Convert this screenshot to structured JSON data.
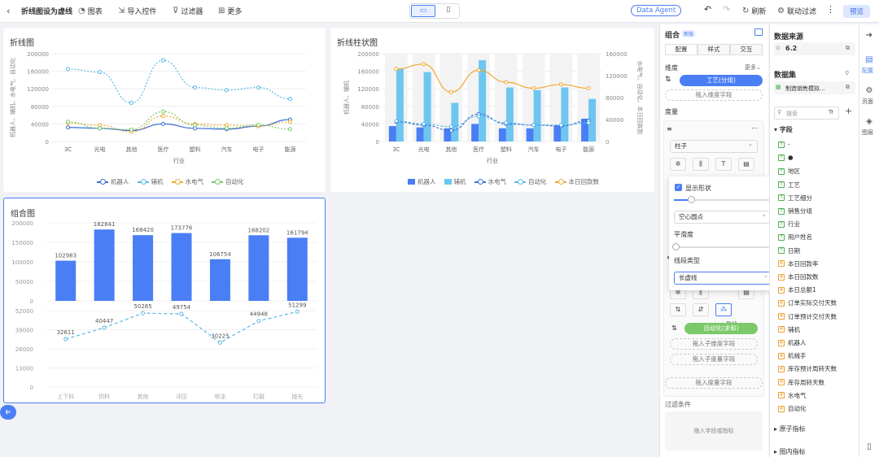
{
  "topbar": {
    "back_icon": "chevron-left-icon",
    "title": "折线图设为虚线",
    "chart_btn": "图表",
    "import_btn": "导入控件",
    "filter_btn": "过滤器",
    "more_btn": "更多",
    "data_agent": "Data Agent",
    "refresh": "刷新",
    "linked_filter": "联动过滤",
    "preview": "预览"
  },
  "cards": {
    "line_title": "折线图",
    "linebar_title": "折线柱状图",
    "combo_title": "组合图"
  },
  "chart_data": [
    {
      "type": "line",
      "title": "折线图",
      "categories": [
        "3C",
        "光电",
        "其他",
        "医疗",
        "塑料",
        "汽车",
        "电子",
        "能源"
      ],
      "xlabel": "行业",
      "ylabel": "机器人、辅机、水电气、自动化",
      "ylim": [
        0,
        200000
      ],
      "yticks": [
        "0",
        "40000",
        "80000",
        "120000",
        "160000",
        "200000"
      ],
      "series": [
        {
          "name": "机器人",
          "color": "#3b6fd6",
          "dash": false,
          "values": [
            32000,
            30000,
            25000,
            40000,
            30000,
            28000,
            35000,
            50000
          ]
        },
        {
          "name": "辅机",
          "color": "#5ab8e8",
          "dash": true,
          "values": [
            165000,
            158000,
            88000,
            185000,
            123000,
            117000,
            123000,
            97000
          ]
        },
        {
          "name": "水电气",
          "color": "#f0a830",
          "dash": true,
          "values": [
            42000,
            37000,
            22000,
            58000,
            40000,
            37000,
            35000,
            45000
          ]
        },
        {
          "name": "自动化",
          "color": "#7cc96a",
          "dash": true,
          "values": [
            45000,
            30000,
            27000,
            68000,
            37000,
            30000,
            38000,
            28000
          ]
        }
      ],
      "legend": "bottom"
    },
    {
      "type": "bar",
      "title": "折线柱状图",
      "categories": [
        "3C",
        "光电",
        "其他",
        "医疗",
        "塑料",
        "汽车",
        "电子",
        "能源"
      ],
      "xlabel": "行业",
      "ylabel": "机器人、辅机",
      "ylabel_right": "水电气、自动化、本日回款数",
      "ylim": [
        0,
        200000
      ],
      "ylim_right": [
        0,
        160000
      ],
      "yticks": [
        "0",
        "40000",
        "80000",
        "120000",
        "160000",
        "200000"
      ],
      "yticks_right": [
        "0",
        "40000",
        "80000",
        "120000",
        "160000"
      ],
      "bar_series": [
        {
          "name": "机器人",
          "color": "#4a7ef5",
          "values": [
            35000,
            32000,
            30000,
            40000,
            30000,
            30000,
            37000,
            52000
          ]
        },
        {
          "name": "辅机",
          "color": "#6ec6f0",
          "values": [
            165000,
            158000,
            88000,
            185000,
            123000,
            117000,
            123000,
            97000
          ]
        }
      ],
      "line_series": [
        {
          "name": "水电气",
          "color": "#3b6fd6",
          "values": [
            36000,
            30000,
            20000,
            50000,
            32000,
            30000,
            28000,
            38000
          ]
        },
        {
          "name": "自动化",
          "color": "#5ab8e8",
          "values": [
            37000,
            32000,
            27000,
            46000,
            34000,
            30000,
            30000,
            34000
          ]
        },
        {
          "name": "本日回款数",
          "color": "#f0a830",
          "values": [
            132000,
            141000,
            90000,
            130000,
            108000,
            97000,
            104000,
            97000
          ]
        }
      ],
      "legend": "bottom"
    },
    {
      "type": "bar",
      "title": "组合图",
      "categories": [
        "上下料",
        "供料",
        "其他",
        "冲压",
        "喷涂",
        "打磨",
        "抛光"
      ],
      "bar_values": [
        102983,
        182841,
        168420,
        173776,
        106754,
        168202,
        161794
      ],
      "bar_ylim": [
        0,
        200000
      ],
      "bar_yticks": [
        "0",
        "50000",
        "100000",
        "150000",
        "200000"
      ],
      "line_values": [
        32611,
        40447,
        50285,
        49754,
        30225,
        44948,
        51299
      ],
      "line_ylim": [
        0,
        52000
      ],
      "line_yticks": [
        "0",
        "13000",
        "26000",
        "39000",
        "52000"
      ],
      "bar_labels": [
        "102983",
        "182841",
        "168420",
        "173776",
        "106754",
        "168202",
        "161794"
      ],
      "line_labels": [
        "32611",
        "40447",
        "50285",
        "49754",
        "30225",
        "44948",
        "51299"
      ]
    }
  ],
  "config": {
    "header": "组合",
    "badge": "新版",
    "tabs": [
      "配置",
      "样式",
      "交互"
    ],
    "dimension_label": "维度",
    "more": "更多",
    "dimension_pill": "工艺(分组)",
    "drop_dim": "拖入维度字段",
    "measure_label": "度量",
    "chart_type": "柱子",
    "auto_pill": "自动化(求和)",
    "drop_sub_dim": "拖入子维度字段",
    "drop_sub_measure": "拖入子度量字段",
    "drop_measure": "拖入度量字段",
    "filter_label": "过滤条件",
    "drop_filter": "拖入字段或指标",
    "tooltip_shape": "形状"
  },
  "popup": {
    "show_shape": "显示形状",
    "shape_select": "空心圆点",
    "smooth_label": "平滑度",
    "line_type_label": "线段类型",
    "line_type_select": "长虚线"
  },
  "datasource": {
    "title": "数据来源",
    "version": "6.2",
    "dataset_label": "数据集",
    "dataset_name": "制造销售模拟...",
    "search_placeholder": "搜索",
    "fields_label": "字段",
    "fields": [
      {
        "name": "-",
        "type": "text"
      },
      {
        "name": "●",
        "type": "text"
      },
      {
        "name": "地区",
        "type": "text"
      },
      {
        "name": "工艺",
        "type": "text"
      },
      {
        "name": "工艺细分",
        "type": "text"
      },
      {
        "name": "销售分组",
        "type": "text"
      },
      {
        "name": "行业",
        "type": "text"
      },
      {
        "name": "用户姓名",
        "type": "text"
      },
      {
        "name": "日期",
        "type": "text"
      },
      {
        "name": "本日回款率",
        "type": "num"
      },
      {
        "name": "本日回款数",
        "type": "num"
      },
      {
        "name": "本日总额1",
        "type": "num"
      },
      {
        "name": "订单实际交付天数",
        "type": "num"
      },
      {
        "name": "订单预计交付天数",
        "type": "num"
      },
      {
        "name": "辅机",
        "type": "num"
      },
      {
        "name": "机器人",
        "type": "num"
      },
      {
        "name": "机械手",
        "type": "num"
      },
      {
        "name": "库存预计周转天数",
        "type": "num"
      },
      {
        "name": "库存周转天数",
        "type": "num"
      },
      {
        "name": "水电气",
        "type": "num"
      },
      {
        "name": "自动化",
        "type": "num"
      }
    ],
    "atomic_metrics": "原子指标",
    "chart_metrics": "图内指标"
  },
  "rightbar": {
    "config": "配置",
    "page": "页面",
    "layer": "图层"
  }
}
